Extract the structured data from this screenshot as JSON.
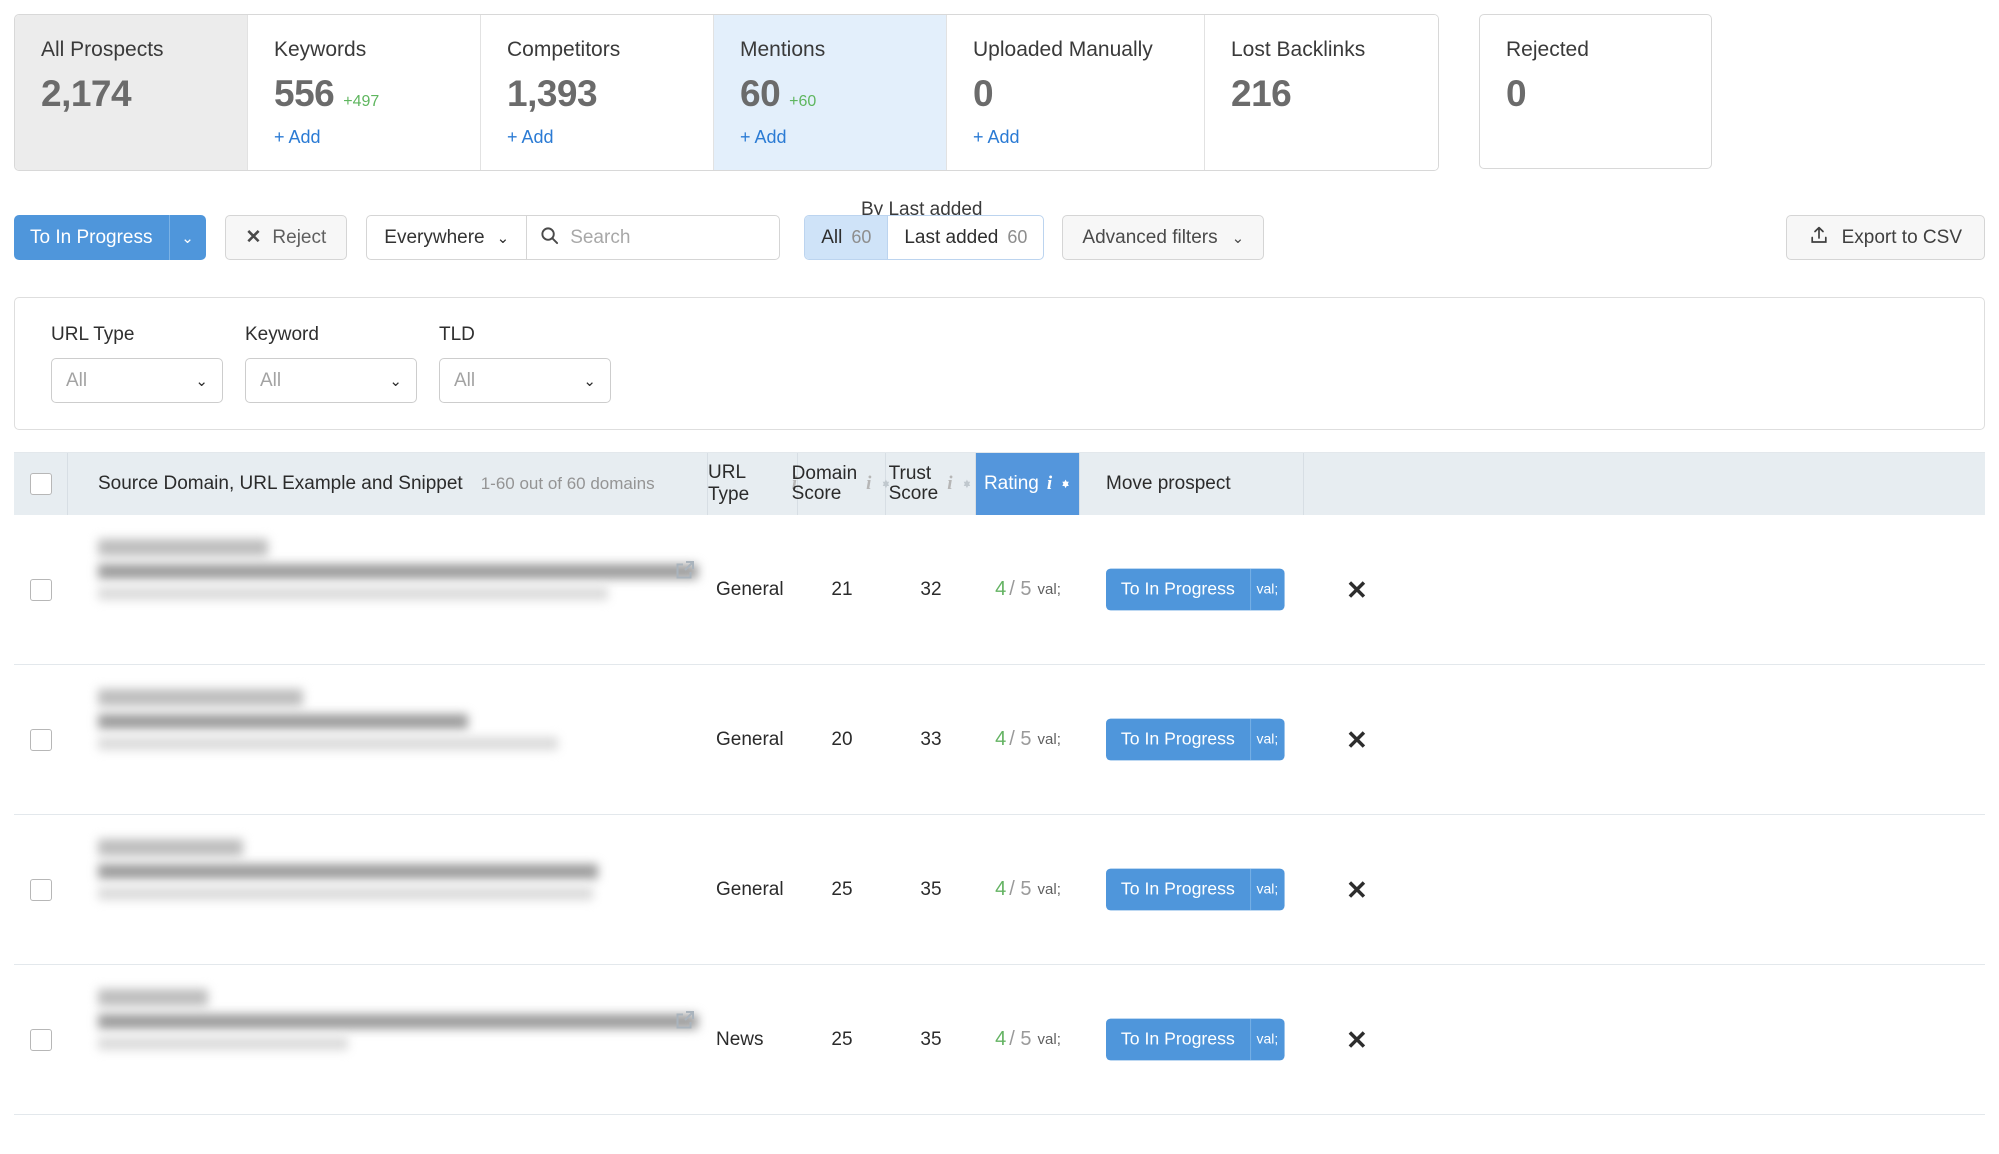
{
  "stats": {
    "cards": [
      {
        "label": "All Prospects",
        "value": "2,174",
        "delta": "",
        "add": "",
        "state": "selected"
      },
      {
        "label": "Keywords",
        "value": "556",
        "delta": "+497",
        "add": "+ Add",
        "state": ""
      },
      {
        "label": "Competitors",
        "value": "1,393",
        "delta": "",
        "add": "+ Add",
        "state": ""
      },
      {
        "label": "Mentions",
        "value": "60",
        "delta": "+60",
        "add": "+ Add",
        "state": "active"
      },
      {
        "label": "Uploaded Manually",
        "value": "0",
        "delta": "",
        "add": "+ Add",
        "state": ""
      },
      {
        "label": "Lost Backlinks",
        "value": "216",
        "delta": "",
        "add": "",
        "state": ""
      }
    ],
    "standalone": {
      "label": "Rejected",
      "value": "0"
    }
  },
  "toolbar": {
    "sort_caption": "By Last added",
    "move_button": "To In Progress",
    "reject_button": "Reject",
    "scope_select": "Everywhere",
    "search_placeholder": "Search",
    "search_value": "",
    "segments": [
      {
        "label": "All",
        "count": "60",
        "active": true
      },
      {
        "label": "Last added",
        "count": "60",
        "active": false
      }
    ],
    "advanced_filters": "Advanced filters",
    "export_button": "Export to CSV"
  },
  "filters": [
    {
      "label": "URL Type",
      "value": "All"
    },
    {
      "label": "Keyword",
      "value": "All"
    },
    {
      "label": "TLD",
      "value": "All"
    }
  ],
  "table": {
    "headers": {
      "source": "Source Domain, URL Example and Snippet",
      "source_count": "1-60 out of 60 domains",
      "url_type": "URL Type",
      "domain_score_l1": "Domain",
      "domain_score_l2": "Score",
      "trust_score_l1": "Trust",
      "trust_score_l2": "Score",
      "rating": "Rating",
      "move_prospect": "Move prospect"
    },
    "rows": [
      {
        "url_type": "General",
        "domain_score": "21",
        "trust_score": "32",
        "rating_value": "4",
        "rating_max": "/ 5",
        "move_label": "To In Progress",
        "has_extlink": true
      },
      {
        "url_type": "General",
        "domain_score": "20",
        "trust_score": "33",
        "rating_value": "4",
        "rating_max": "/ 5",
        "move_label": "To In Progress",
        "has_extlink": false
      },
      {
        "url_type": "General",
        "domain_score": "25",
        "trust_score": "35",
        "rating_value": "4",
        "rating_max": "/ 5",
        "move_label": "To In Progress",
        "has_extlink": false
      },
      {
        "url_type": "News",
        "domain_score": "25",
        "trust_score": "35",
        "rating_value": "4",
        "rating_max": "/ 5",
        "move_label": "To In Progress",
        "has_extlink": true
      }
    ]
  },
  "colors": {
    "accent_blue": "#5496dc",
    "link_blue": "#2b7bd4",
    "positive_green": "#5fb65f",
    "rating_green": "#64b363",
    "active_card_bg": "#e3effb",
    "header_bg": "#e7edf1"
  }
}
